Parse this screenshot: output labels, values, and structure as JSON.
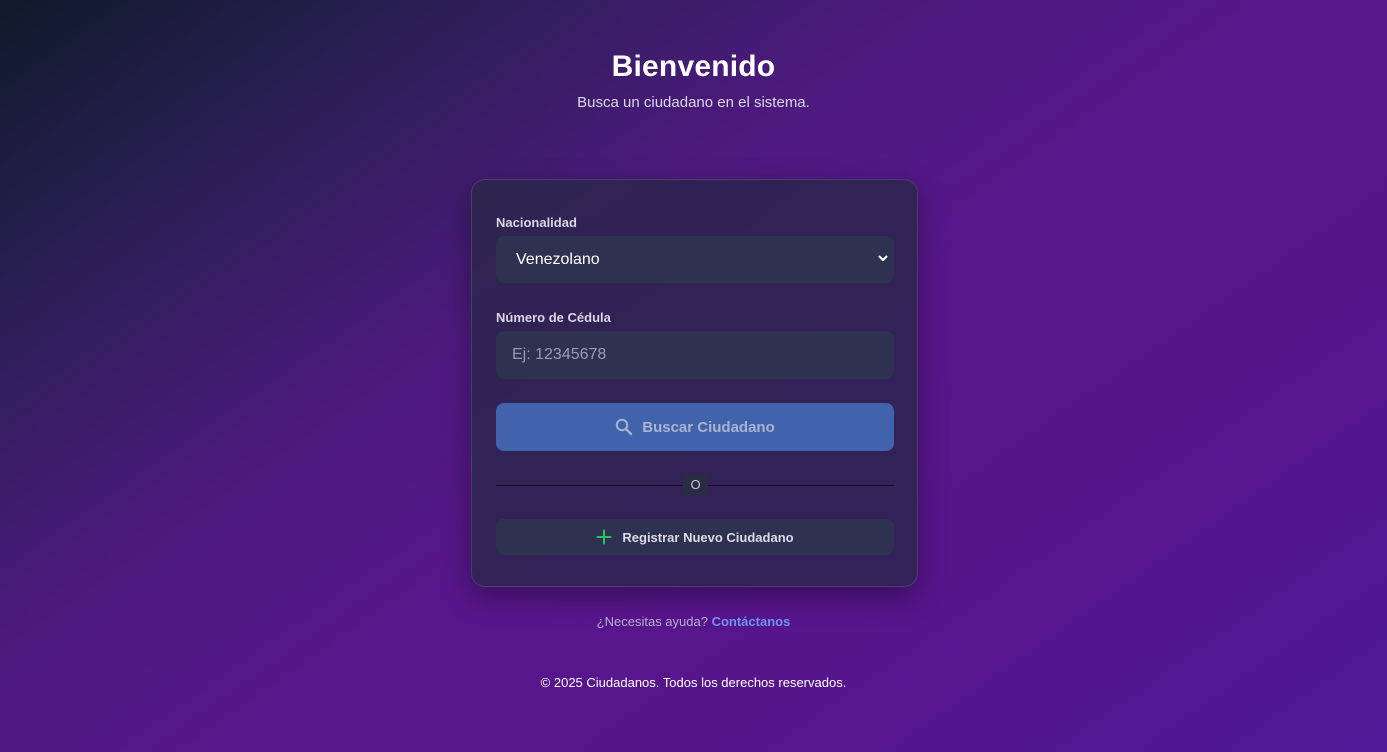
{
  "header": {
    "title": "Bienvenido",
    "subtitle": "Busca un ciudadano en el sistema."
  },
  "form": {
    "nationality_label": "Nacionalidad",
    "nationality_value": "Venezolano",
    "id_label": "Número de Cédula",
    "id_placeholder": "Ej: 12345678",
    "id_value": "",
    "search_button": "Buscar Ciudadano",
    "divider_text": "O",
    "register_button": "Registrar Nuevo Ciudadano"
  },
  "help": {
    "question": "¿Necesitas ayuda?",
    "link": "Contáctanos"
  },
  "footer": {
    "text": "© 2025 Ciudadanos. Todos los derechos reservados."
  },
  "icons": {
    "search": "search-icon",
    "plus": "plus-icon",
    "chevron": "chevron-down-icon"
  },
  "colors": {
    "primary_button": "#4063ac",
    "field_background": "#2e3250",
    "link": "#6e93f5",
    "plus_icon": "#22c55e"
  }
}
